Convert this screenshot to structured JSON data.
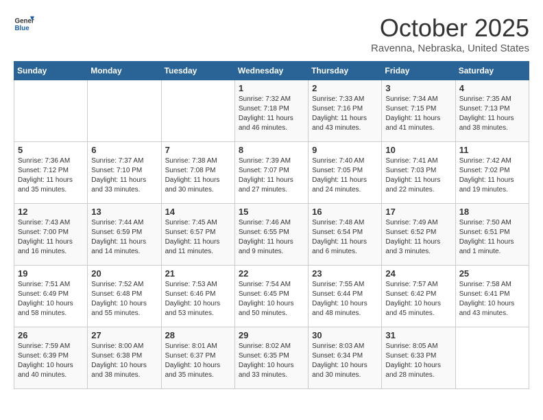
{
  "header": {
    "logo_general": "General",
    "logo_blue": "Blue",
    "month_title": "October 2025",
    "location": "Ravenna, Nebraska, United States"
  },
  "days_of_week": [
    "Sunday",
    "Monday",
    "Tuesday",
    "Wednesday",
    "Thursday",
    "Friday",
    "Saturday"
  ],
  "weeks": [
    [
      {
        "day": "",
        "info": ""
      },
      {
        "day": "",
        "info": ""
      },
      {
        "day": "",
        "info": ""
      },
      {
        "day": "1",
        "info": "Sunrise: 7:32 AM\nSunset: 7:18 PM\nDaylight: 11 hours\nand 46 minutes."
      },
      {
        "day": "2",
        "info": "Sunrise: 7:33 AM\nSunset: 7:16 PM\nDaylight: 11 hours\nand 43 minutes."
      },
      {
        "day": "3",
        "info": "Sunrise: 7:34 AM\nSunset: 7:15 PM\nDaylight: 11 hours\nand 41 minutes."
      },
      {
        "day": "4",
        "info": "Sunrise: 7:35 AM\nSunset: 7:13 PM\nDaylight: 11 hours\nand 38 minutes."
      }
    ],
    [
      {
        "day": "5",
        "info": "Sunrise: 7:36 AM\nSunset: 7:12 PM\nDaylight: 11 hours\nand 35 minutes."
      },
      {
        "day": "6",
        "info": "Sunrise: 7:37 AM\nSunset: 7:10 PM\nDaylight: 11 hours\nand 33 minutes."
      },
      {
        "day": "7",
        "info": "Sunrise: 7:38 AM\nSunset: 7:08 PM\nDaylight: 11 hours\nand 30 minutes."
      },
      {
        "day": "8",
        "info": "Sunrise: 7:39 AM\nSunset: 7:07 PM\nDaylight: 11 hours\nand 27 minutes."
      },
      {
        "day": "9",
        "info": "Sunrise: 7:40 AM\nSunset: 7:05 PM\nDaylight: 11 hours\nand 24 minutes."
      },
      {
        "day": "10",
        "info": "Sunrise: 7:41 AM\nSunset: 7:03 PM\nDaylight: 11 hours\nand 22 minutes."
      },
      {
        "day": "11",
        "info": "Sunrise: 7:42 AM\nSunset: 7:02 PM\nDaylight: 11 hours\nand 19 minutes."
      }
    ],
    [
      {
        "day": "12",
        "info": "Sunrise: 7:43 AM\nSunset: 7:00 PM\nDaylight: 11 hours\nand 16 minutes."
      },
      {
        "day": "13",
        "info": "Sunrise: 7:44 AM\nSunset: 6:59 PM\nDaylight: 11 hours\nand 14 minutes."
      },
      {
        "day": "14",
        "info": "Sunrise: 7:45 AM\nSunset: 6:57 PM\nDaylight: 11 hours\nand 11 minutes."
      },
      {
        "day": "15",
        "info": "Sunrise: 7:46 AM\nSunset: 6:55 PM\nDaylight: 11 hours\nand 9 minutes."
      },
      {
        "day": "16",
        "info": "Sunrise: 7:48 AM\nSunset: 6:54 PM\nDaylight: 11 hours\nand 6 minutes."
      },
      {
        "day": "17",
        "info": "Sunrise: 7:49 AM\nSunset: 6:52 PM\nDaylight: 11 hours\nand 3 minutes."
      },
      {
        "day": "18",
        "info": "Sunrise: 7:50 AM\nSunset: 6:51 PM\nDaylight: 11 hours\nand 1 minute."
      }
    ],
    [
      {
        "day": "19",
        "info": "Sunrise: 7:51 AM\nSunset: 6:49 PM\nDaylight: 10 hours\nand 58 minutes."
      },
      {
        "day": "20",
        "info": "Sunrise: 7:52 AM\nSunset: 6:48 PM\nDaylight: 10 hours\nand 55 minutes."
      },
      {
        "day": "21",
        "info": "Sunrise: 7:53 AM\nSunset: 6:46 PM\nDaylight: 10 hours\nand 53 minutes."
      },
      {
        "day": "22",
        "info": "Sunrise: 7:54 AM\nSunset: 6:45 PM\nDaylight: 10 hours\nand 50 minutes."
      },
      {
        "day": "23",
        "info": "Sunrise: 7:55 AM\nSunset: 6:44 PM\nDaylight: 10 hours\nand 48 minutes."
      },
      {
        "day": "24",
        "info": "Sunrise: 7:57 AM\nSunset: 6:42 PM\nDaylight: 10 hours\nand 45 minutes."
      },
      {
        "day": "25",
        "info": "Sunrise: 7:58 AM\nSunset: 6:41 PM\nDaylight: 10 hours\nand 43 minutes."
      }
    ],
    [
      {
        "day": "26",
        "info": "Sunrise: 7:59 AM\nSunset: 6:39 PM\nDaylight: 10 hours\nand 40 minutes."
      },
      {
        "day": "27",
        "info": "Sunrise: 8:00 AM\nSunset: 6:38 PM\nDaylight: 10 hours\nand 38 minutes."
      },
      {
        "day": "28",
        "info": "Sunrise: 8:01 AM\nSunset: 6:37 PM\nDaylight: 10 hours\nand 35 minutes."
      },
      {
        "day": "29",
        "info": "Sunrise: 8:02 AM\nSunset: 6:35 PM\nDaylight: 10 hours\nand 33 minutes."
      },
      {
        "day": "30",
        "info": "Sunrise: 8:03 AM\nSunset: 6:34 PM\nDaylight: 10 hours\nand 30 minutes."
      },
      {
        "day": "31",
        "info": "Sunrise: 8:05 AM\nSunset: 6:33 PM\nDaylight: 10 hours\nand 28 minutes."
      },
      {
        "day": "",
        "info": ""
      }
    ]
  ]
}
